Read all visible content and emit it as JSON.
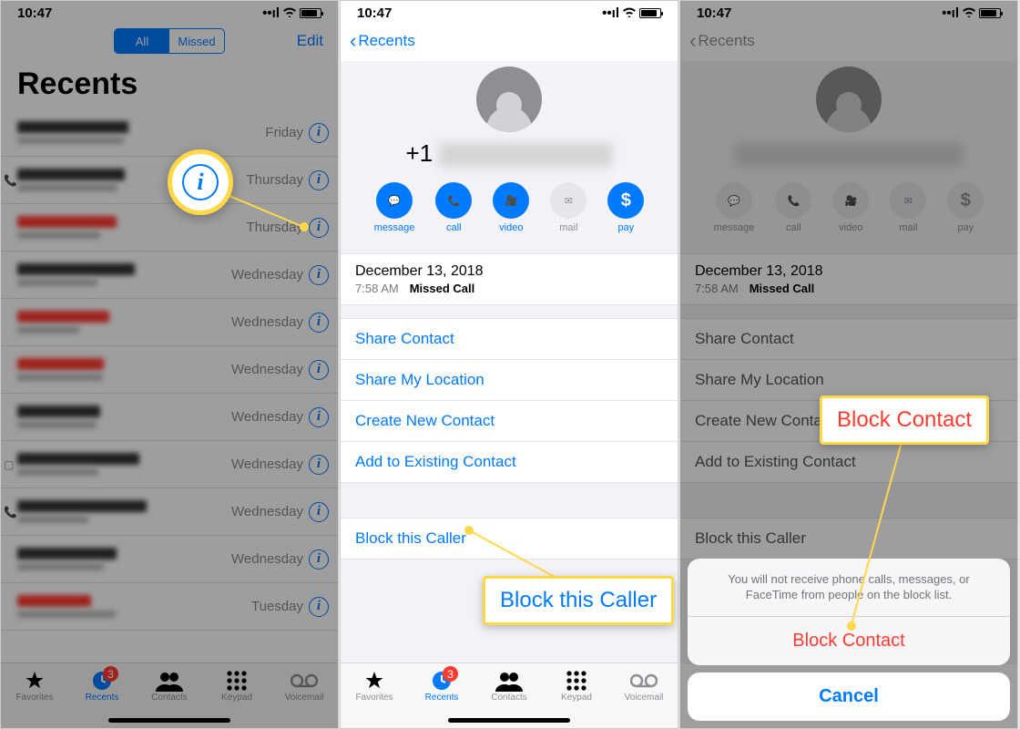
{
  "status": {
    "time": "10:47",
    "location_arrow": "➤"
  },
  "screen1": {
    "segment": {
      "all": "All",
      "missed": "Missed"
    },
    "edit": "Edit",
    "title": "Recents",
    "rows": [
      {
        "date": "Friday",
        "missed": false,
        "lead": ""
      },
      {
        "date": "Thursday",
        "missed": false,
        "lead": "call"
      },
      {
        "date": "Thursday",
        "missed": true,
        "lead": ""
      },
      {
        "date": "Wednesday",
        "missed": false,
        "lead": ""
      },
      {
        "date": "Wednesday",
        "missed": true,
        "lead": ""
      },
      {
        "date": "Wednesday",
        "missed": true,
        "lead": ""
      },
      {
        "date": "Wednesday",
        "missed": false,
        "lead": ""
      },
      {
        "date": "Wednesday",
        "missed": false,
        "lead": "msg"
      },
      {
        "date": "Wednesday",
        "missed": false,
        "lead": "call"
      },
      {
        "date": "Wednesday",
        "missed": false,
        "lead": ""
      },
      {
        "date": "Tuesday",
        "missed": true,
        "lead": ""
      }
    ]
  },
  "detail": {
    "back": "Recents",
    "number_prefix": "+1",
    "actions": [
      {
        "key": "message",
        "label": "message",
        "state": "blue"
      },
      {
        "key": "call",
        "label": "call",
        "state": "blue"
      },
      {
        "key": "video",
        "label": "video",
        "state": "blue"
      },
      {
        "key": "mail",
        "label": "mail",
        "state": "gray"
      },
      {
        "key": "pay",
        "label": "pay",
        "state": "blue"
      }
    ],
    "card": {
      "date": "December 13, 2018",
      "time": "7:58 AM",
      "status": "Missed Call"
    },
    "links": {
      "share_contact": "Share Contact",
      "share_location": "Share My Location",
      "create_contact": "Create New Contact",
      "add_contact": "Add to Existing Contact",
      "block": "Block this Caller"
    }
  },
  "sheet": {
    "message": "You will not receive phone calls, messages, or FaceTime from people on the block list.",
    "block": "Block Contact",
    "cancel": "Cancel"
  },
  "tabs": {
    "favorites": "Favorites",
    "recents": "Recents",
    "contacts": "Contacts",
    "keypad": "Keypad",
    "voicemail": "Voicemail",
    "badge": "3"
  },
  "callouts": {
    "block_this_caller": "Block this Caller",
    "block_contact": "Block Contact"
  }
}
